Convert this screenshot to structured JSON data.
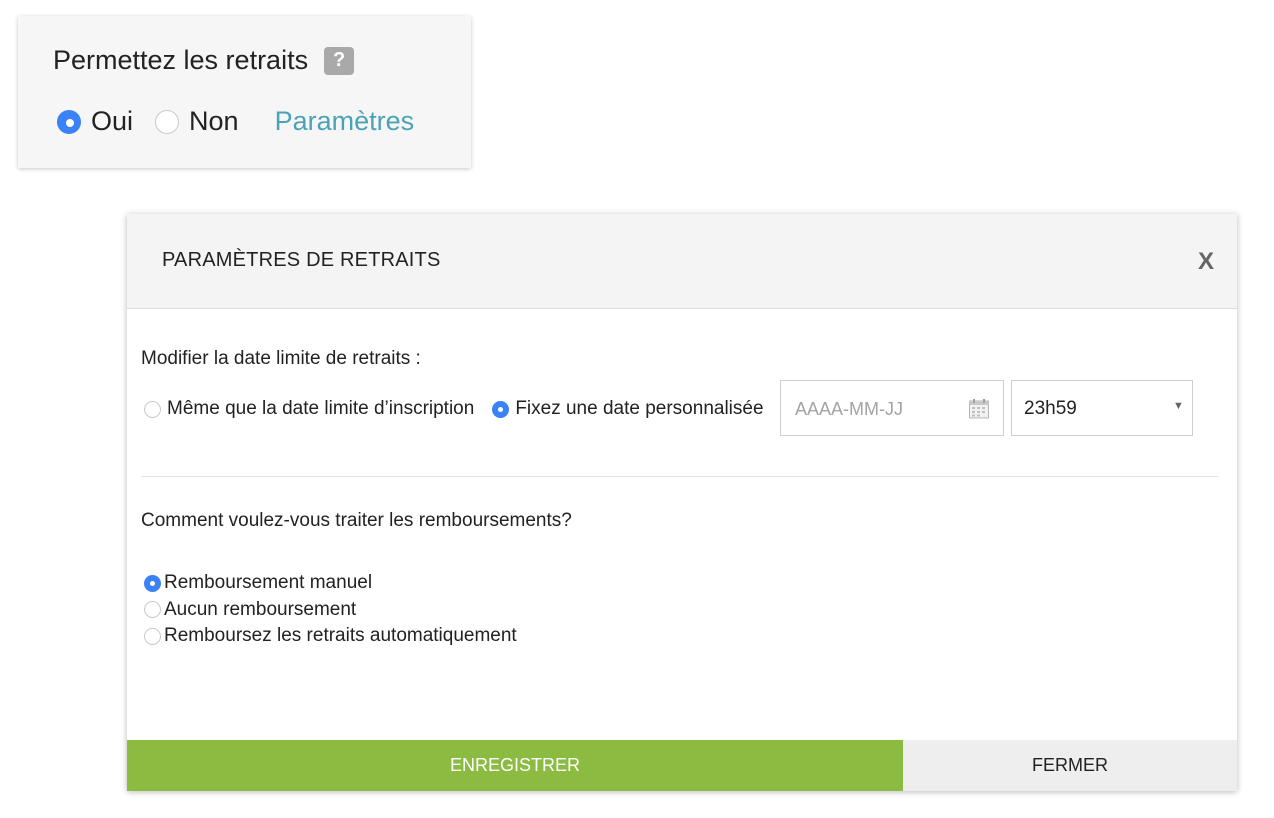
{
  "withdrawals_card": {
    "title": "Permettez les retraits",
    "help_icon": "?",
    "options": [
      {
        "label": "Oui",
        "selected": true
      },
      {
        "label": "Non",
        "selected": false
      }
    ],
    "settings_link": "Paramètres"
  },
  "modal": {
    "title": "PARAMÈTRES DE RETRAITS",
    "close_icon": "X",
    "deadline": {
      "label": "Modifier la date limite de retraits :",
      "options": [
        {
          "label": "Même que la date limite d’inscription",
          "selected": false
        },
        {
          "label": "Fixez une date personnalisée",
          "selected": true
        }
      ],
      "date_placeholder": "AAAA-MM-JJ",
      "date_value": "",
      "time_value": "23h59"
    },
    "refunds": {
      "label": "Comment voulez-vous traiter les remboursements?",
      "options": [
        {
          "label": "Remboursement manuel",
          "selected": true
        },
        {
          "label": "Aucun remboursement",
          "selected": false
        },
        {
          "label": "Remboursez les retraits automatiquement",
          "selected": false
        }
      ]
    },
    "buttons": {
      "save": "ENREGISTRER",
      "close": "FERMER"
    }
  },
  "colors": {
    "accent_blue": "#3b82f6",
    "link": "#4aa3b5",
    "save_green": "#8bbb40"
  }
}
